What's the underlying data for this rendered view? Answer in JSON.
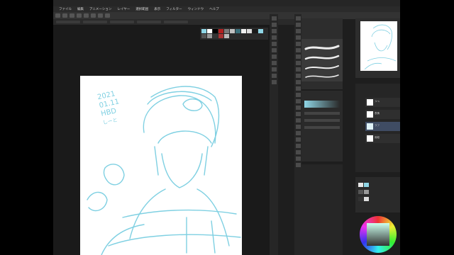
{
  "menu": {
    "items": [
      "ファイル",
      "編集",
      "アニメーション",
      "レイヤー",
      "選択範囲",
      "表示",
      "フィルター",
      "ウィンドウ",
      "ヘルプ"
    ]
  },
  "canvas": {
    "drawing_text": [
      "2021",
      "01.11",
      "HBD",
      "しーと"
    ]
  },
  "layers": {
    "items": [
      "ﾌﾚｰﾑ",
      "表情",
      "ラフ",
      "用紙"
    ]
  },
  "colors": {
    "palette": [
      "#8fd6e6",
      "#ffffff",
      "#000000",
      "#7a7a7a",
      "#c0c0c0",
      "#b22020",
      "#f0f0f0",
      "#3a6f7a",
      "#1a1a1a",
      "#dddddd"
    ],
    "sketch_line": "#7fd0e2",
    "accent_wheel_ring": "#cc3333"
  }
}
